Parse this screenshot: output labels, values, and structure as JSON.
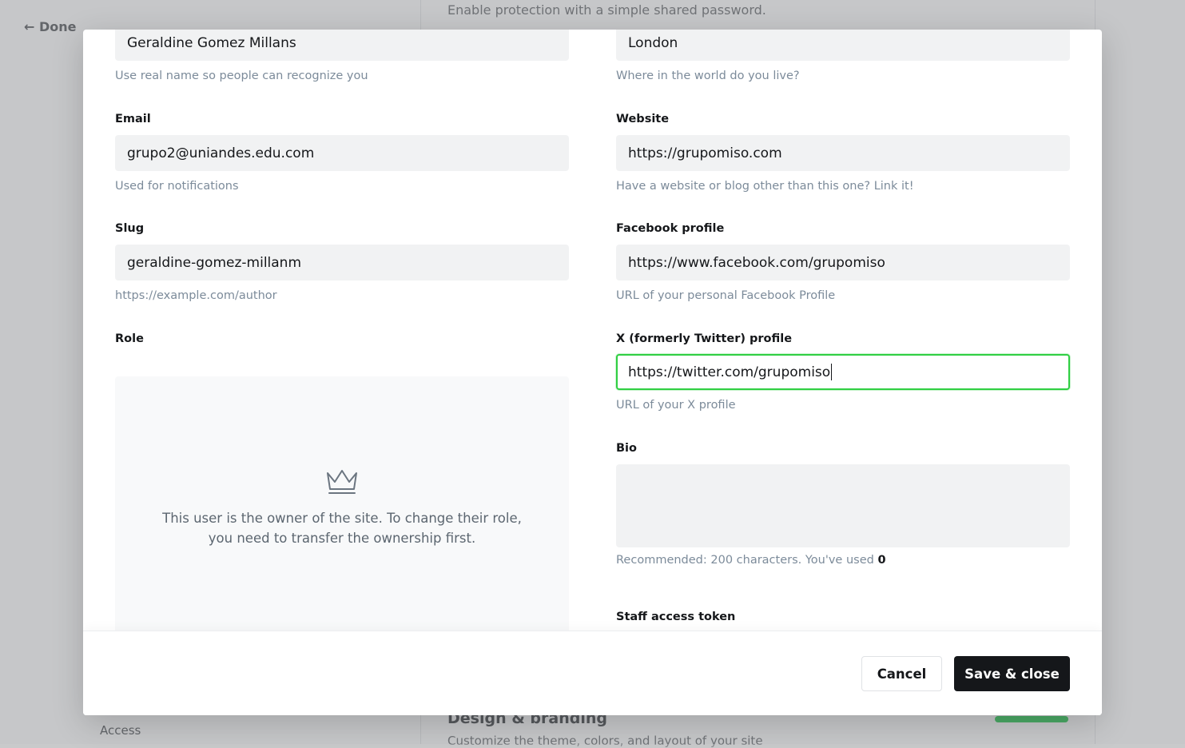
{
  "background": {
    "done_label": "← Done",
    "top_text": "Enable protection with a simple shared password.",
    "bottom_title": "Design & branding",
    "bottom_sub": "Customize the theme, colors, and layout of your site",
    "access_label": "Access"
  },
  "form": {
    "name": {
      "value": "Geraldine Gomez Millans",
      "hint": "Use real name so people can recognize you"
    },
    "location": {
      "value": "London",
      "hint": "Where in the world do you live?"
    },
    "email": {
      "label": "Email",
      "value": "grupo2@uniandes.edu.com",
      "hint": "Used for notifications"
    },
    "website": {
      "label": "Website",
      "value": "https://grupomiso.com",
      "hint": "Have a website or blog other than this one? Link it!"
    },
    "slug": {
      "label": "Slug",
      "value": "geraldine-gomez-millanm",
      "hint": "https://example.com/author"
    },
    "facebook": {
      "label": "Facebook profile",
      "value": "https://www.facebook.com/grupomiso",
      "hint": "URL of your personal Facebook Profile"
    },
    "role": {
      "label": "Role",
      "owner_message": "This user is the owner of the site. To change their role, you need to transfer the ownership first."
    },
    "twitter": {
      "label": "X (formerly Twitter) profile",
      "value": "https://twitter.com/grupomiso",
      "hint": "URL of your X profile"
    },
    "bio": {
      "label": "Bio",
      "hint_prefix": "Recommended: 200 characters. You've used",
      "count": "0"
    },
    "staff_token": {
      "label": "Staff access token"
    }
  },
  "footer": {
    "cancel_label": "Cancel",
    "save_label": "Save & close"
  },
  "colors": {
    "accent_focus": "#30cf43",
    "primary_button": "#15171a"
  },
  "icons": {
    "role": "crown-icon"
  }
}
